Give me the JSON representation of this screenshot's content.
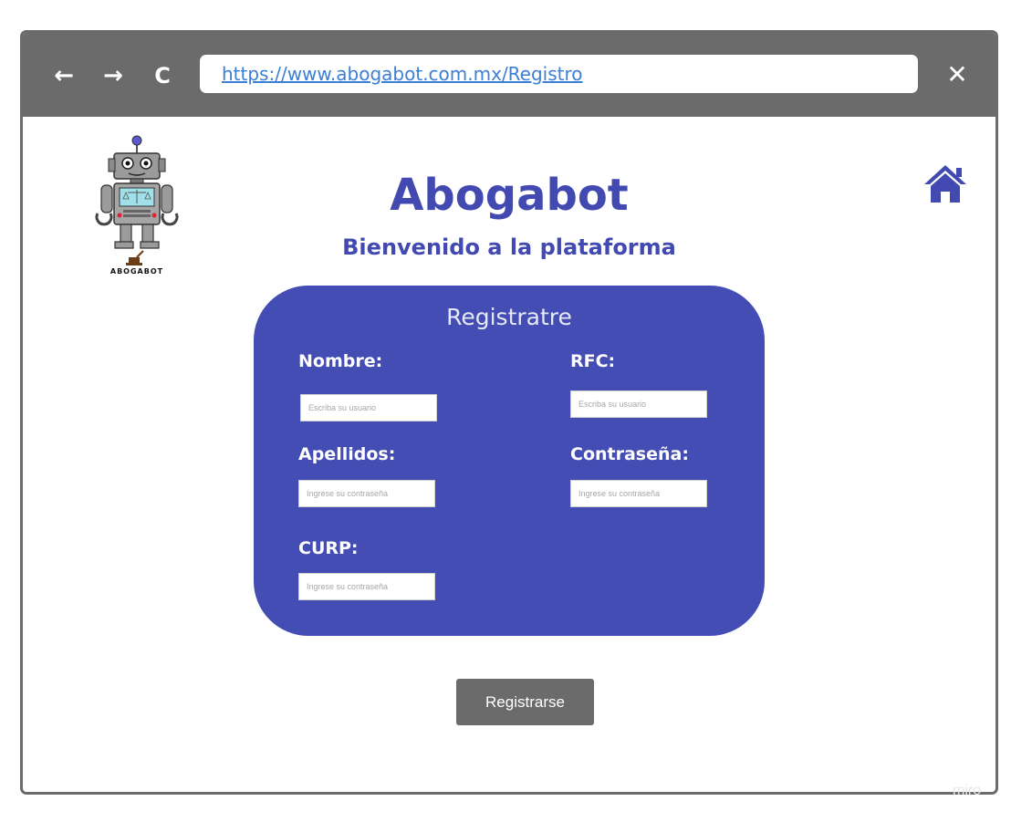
{
  "browser": {
    "back_icon": "arrow-left-icon",
    "forward_icon": "arrow-right-icon",
    "reload_icon": "reload-icon",
    "url": "https://www.abogabot.com.mx/Registro",
    "close_icon": "close-icon",
    "back_glyph": "←",
    "forward_glyph": "→",
    "reload_glyph": "C",
    "close_glyph": "✕"
  },
  "header": {
    "logo_text": "ABOGABOT",
    "title": "Abogabot",
    "subtitle": "Bienvenido a la plataforma",
    "home_icon": "home-icon"
  },
  "form": {
    "title": "Registratre",
    "fields": {
      "nombre": {
        "label": "Nombre:",
        "placeholder": "Escriba su usuario"
      },
      "rfc": {
        "label": "RFC:",
        "placeholder": "Escriba su usuario"
      },
      "apellidos": {
        "label": "Apellidos:",
        "placeholder": "Ingrese su contraseña"
      },
      "contrasena": {
        "label": "Contraseña:",
        "placeholder": "Ingrese su contraseña"
      },
      "curp": {
        "label": "CURP:",
        "placeholder": "Ingrese su contraseña"
      }
    },
    "submit_label": "Registrarse"
  },
  "watermark": "miro",
  "colors": {
    "brand": "#4249b0",
    "card": "#434db3",
    "chrome": "#6b6b6b",
    "link": "#3b7fd6"
  }
}
